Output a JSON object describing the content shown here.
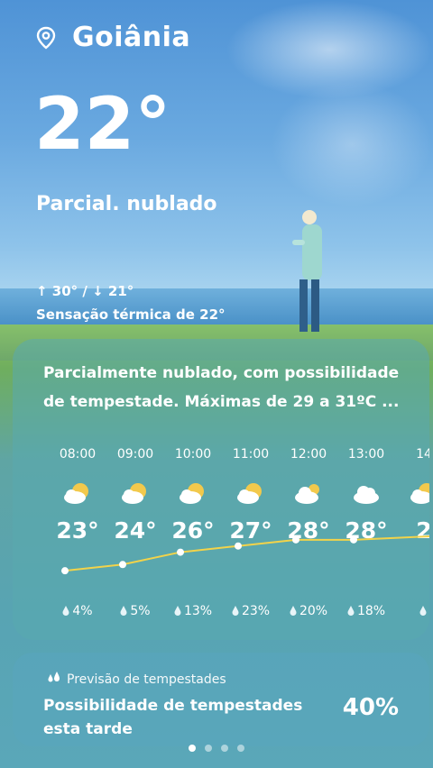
{
  "location": {
    "city": "Goiânia"
  },
  "current": {
    "temp": "22°",
    "condition": "Parcial. nublado",
    "hilo": "↑ 30° / ↓ 21°",
    "feels_like": "Sensação térmica de 22°"
  },
  "summary": "Parcialmente nublado, com possibilidade de tempestade. Máximas de 29 a 31ºC ...",
  "hourly": [
    {
      "time": "08:00",
      "temp": "23°",
      "icon": "partly-cloudy-sun-icon",
      "rain": "4%"
    },
    {
      "time": "09:00",
      "temp": "24°",
      "icon": "partly-cloudy-sun-icon",
      "rain": "5%"
    },
    {
      "time": "10:00",
      "temp": "26°",
      "icon": "partly-cloudy-sun-icon",
      "rain": "13%"
    },
    {
      "time": "11:00",
      "temp": "27°",
      "icon": "partly-cloudy-sun-icon",
      "rain": "23%"
    },
    {
      "time": "12:00",
      "temp": "28°",
      "icon": "cloudy-sun-icon",
      "rain": "20%"
    },
    {
      "time": "13:00",
      "temp": "28°",
      "icon": "cloud-icon",
      "rain": "18%"
    },
    {
      "time": "14",
      "temp": "2",
      "icon": "partly-cloudy-sun-icon",
      "rain": ""
    }
  ],
  "storm": {
    "label": "Previsão de tempestades",
    "title": "Possibilidade de tempestades esta tarde",
    "value": "40%"
  },
  "pager": {
    "count": 4,
    "active": 0
  },
  "colors": {
    "accent": "#f2d34a",
    "card": "#5aaaaf"
  }
}
